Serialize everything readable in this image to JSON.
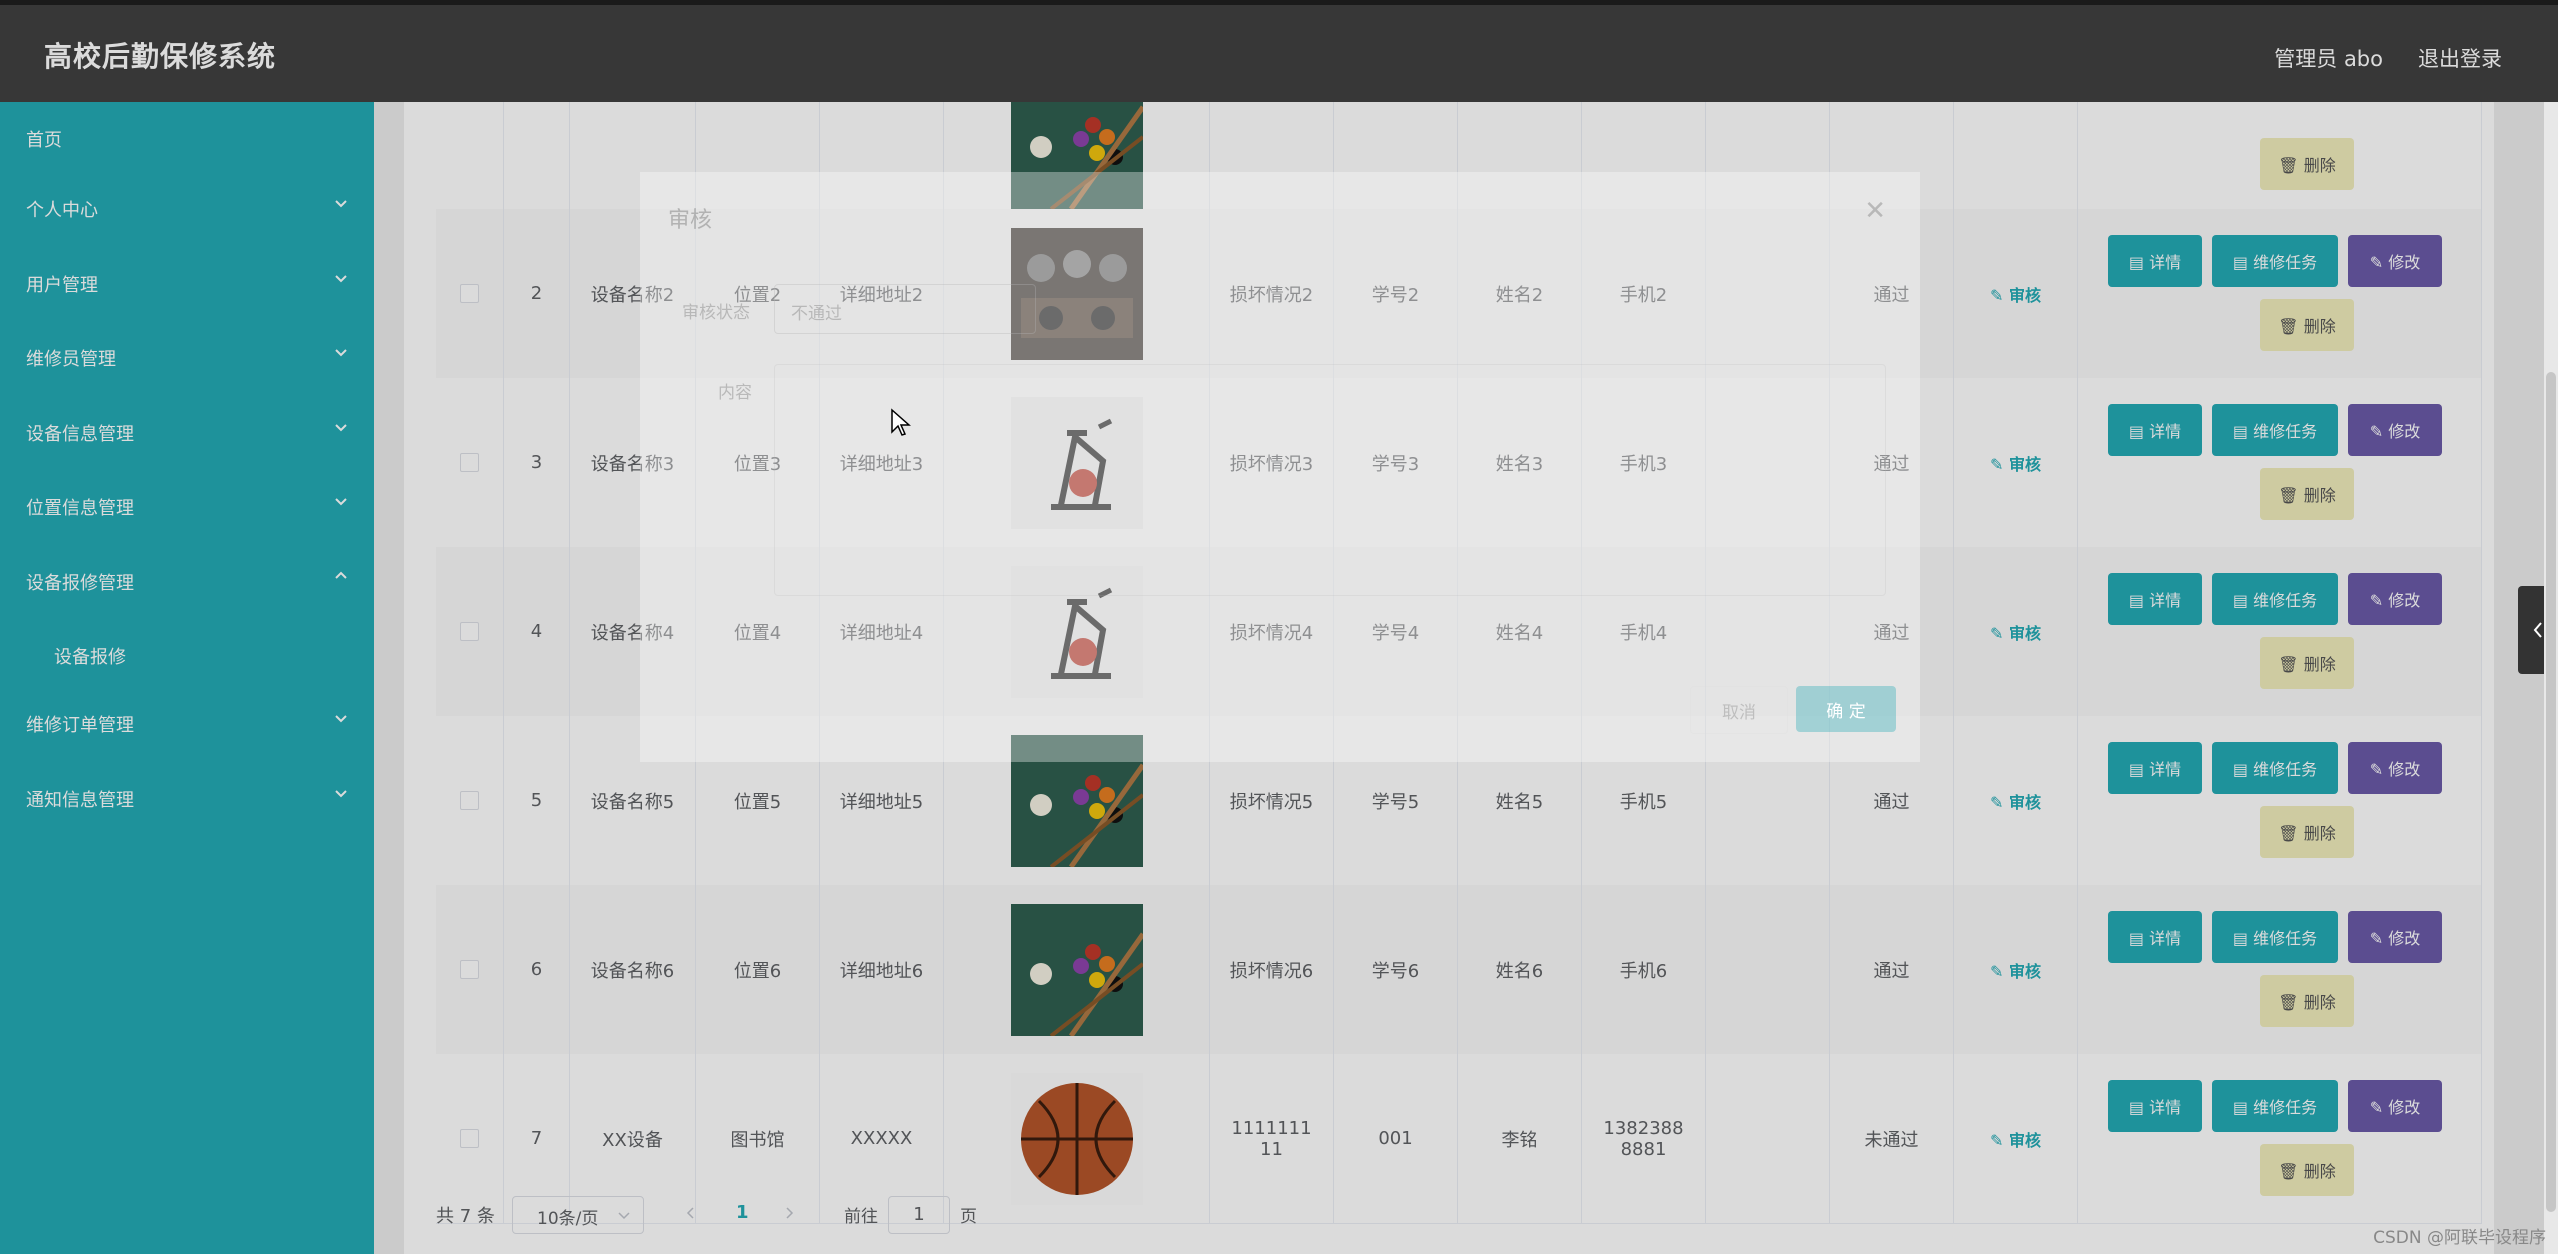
{
  "header": {
    "title": "高校后勤保修系统",
    "user": "管理员 abo",
    "logout": "退出登录"
  },
  "sidebar": {
    "items": [
      {
        "label": "首页"
      },
      {
        "label": "个人中心"
      },
      {
        "label": "用户管理"
      },
      {
        "label": "维修员管理"
      },
      {
        "label": "设备信息管理"
      },
      {
        "label": "位置信息管理"
      },
      {
        "label": "设备报修管理"
      },
      {
        "label": "设备报修"
      },
      {
        "label": "维修订单管理"
      },
      {
        "label": "通知信息管理"
      }
    ]
  },
  "table": {
    "rows": [
      {
        "no": "",
        "name": "",
        "loc": "",
        "addr": "",
        "damage": "",
        "sid": "",
        "sname": "",
        "phone": "",
        "status": "",
        "image": "billiards"
      },
      {
        "no": "2",
        "name": "设备名称2",
        "loc": "位置2",
        "addr": "详细地址2",
        "damage": "损坏情况2",
        "sid": "学号2",
        "sname": "姓名2",
        "phone": "手机2",
        "status": "通过",
        "image": "gym"
      },
      {
        "no": "3",
        "name": "设备名称3",
        "loc": "位置3",
        "addr": "详细地址3",
        "damage": "损坏情况3",
        "sid": "学号3",
        "sname": "姓名3",
        "phone": "手机3",
        "status": "通过",
        "image": "bike"
      },
      {
        "no": "4",
        "name": "设备名称4",
        "loc": "位置4",
        "addr": "详细地址4",
        "damage": "损坏情况4",
        "sid": "学号4",
        "sname": "姓名4",
        "phone": "手机4",
        "status": "通过",
        "image": "bike"
      },
      {
        "no": "5",
        "name": "设备名称5",
        "loc": "位置5",
        "addr": "详细地址5",
        "damage": "损坏情况5",
        "sid": "学号5",
        "sname": "姓名5",
        "phone": "手机5",
        "status": "通过",
        "image": "billiards"
      },
      {
        "no": "6",
        "name": "设备名称6",
        "loc": "位置6",
        "addr": "详细地址6",
        "damage": "损坏情况6",
        "sid": "学号6",
        "sname": "姓名6",
        "phone": "手机6",
        "status": "通过",
        "image": "billiards"
      },
      {
        "no": "7",
        "name": "XX设备",
        "loc": "图书馆",
        "addr": "XXXXX",
        "damage": "111111111",
        "sid": "001",
        "sname": "李铭",
        "phone": "13823888881",
        "status": "未通过",
        "image": "basketball"
      }
    ],
    "actions": {
      "audit": "审核",
      "detail": "详情",
      "task": "维修任务",
      "edit": "修改",
      "delete": "删除"
    }
  },
  "pager": {
    "total": "共 7 条",
    "size": "10条/页",
    "current": "1",
    "goto_prefix": "前往",
    "goto_value": "1",
    "goto_suffix": "页"
  },
  "dialog": {
    "title": "审核",
    "status_label": "审核状态",
    "status_value": "不通过",
    "content_label": "内容",
    "cancel": "取消",
    "ok": "确 定"
  },
  "watermark": "CSDN @阿联毕设程序"
}
